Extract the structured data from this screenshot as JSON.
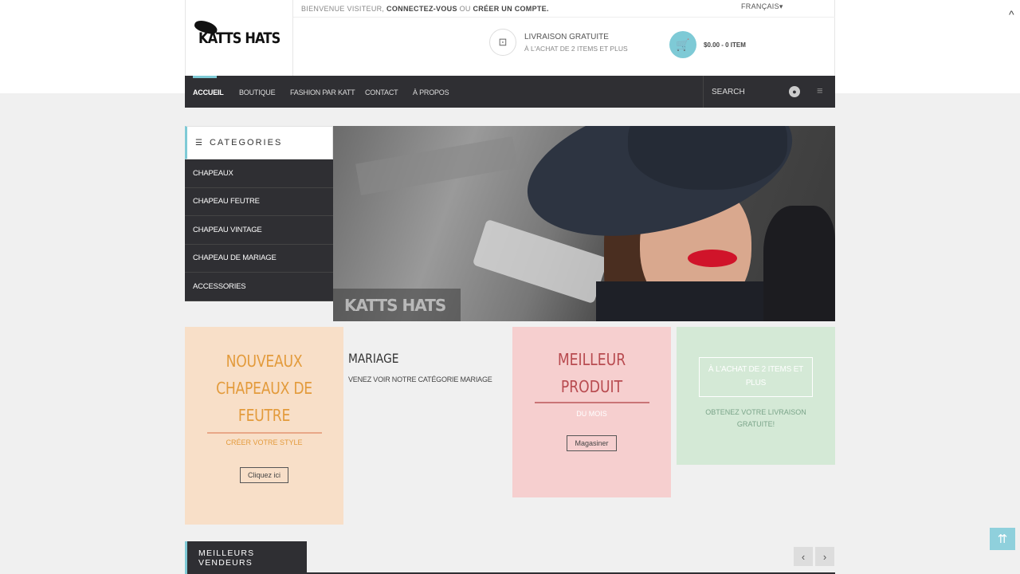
{
  "header": {
    "logo_text": "KATTS HATS",
    "welcome_prefix": "Bienvenue visiteur,",
    "login_link": "Connectez-vous",
    "welcome_or": "ou",
    "register_link": "créer un compte.",
    "language": "FRANÇAIS▾",
    "shipping_title": "LIVRAISON GRATUITE",
    "shipping_sub": "À L'ACHAT DE 2 ITEMS ET PLUS",
    "cart_summary": "$0.00 - 0 ITEM"
  },
  "nav": {
    "items": [
      "ACCUEIL",
      "BOUTIQUE",
      "FASHION PAR KATT",
      "CONTACT",
      "À PROPOS"
    ],
    "search_placeholder": "SEARCH"
  },
  "categories": {
    "title": "CATEGORIES",
    "items": [
      "CHAPEAUX",
      "CHAPEAU FEUTRE",
      "CHAPEAU VINTAGE",
      "CHAPEAU DE MARIAGE",
      "ACCESSORIES"
    ]
  },
  "hero": {
    "watermark": "KATTS HATS"
  },
  "promos": {
    "felt": {
      "line1": "NOUVEAUX",
      "line2": "CHAPEAUX DE",
      "line3": "FEUTRE",
      "sub": "CRÉER VOTRE STYLE",
      "button": "Cliquez ici"
    },
    "wedding": {
      "title": "MARIAGE",
      "desc": "VENEZ VOIR NOTRE CATÉGORIE MARIAGE"
    },
    "best": {
      "line1": "MEILLEUR",
      "line2": "PRODUIT",
      "sub": "DU MOIS",
      "button": "Magasiner"
    },
    "shipping": {
      "frame": "À L'ACHAT DE 2 ITEMS ET PLUS",
      "sub": "OBTENEZ VOTRE LIVRAISON GRATUITE!"
    }
  },
  "best_sellers": {
    "title": "MEILLEURS VENDEURS"
  },
  "colors": {
    "accent": "#7ecad6",
    "dark": "#2f2f33",
    "orange": "#e39b3c",
    "rose": "#b84b50"
  }
}
